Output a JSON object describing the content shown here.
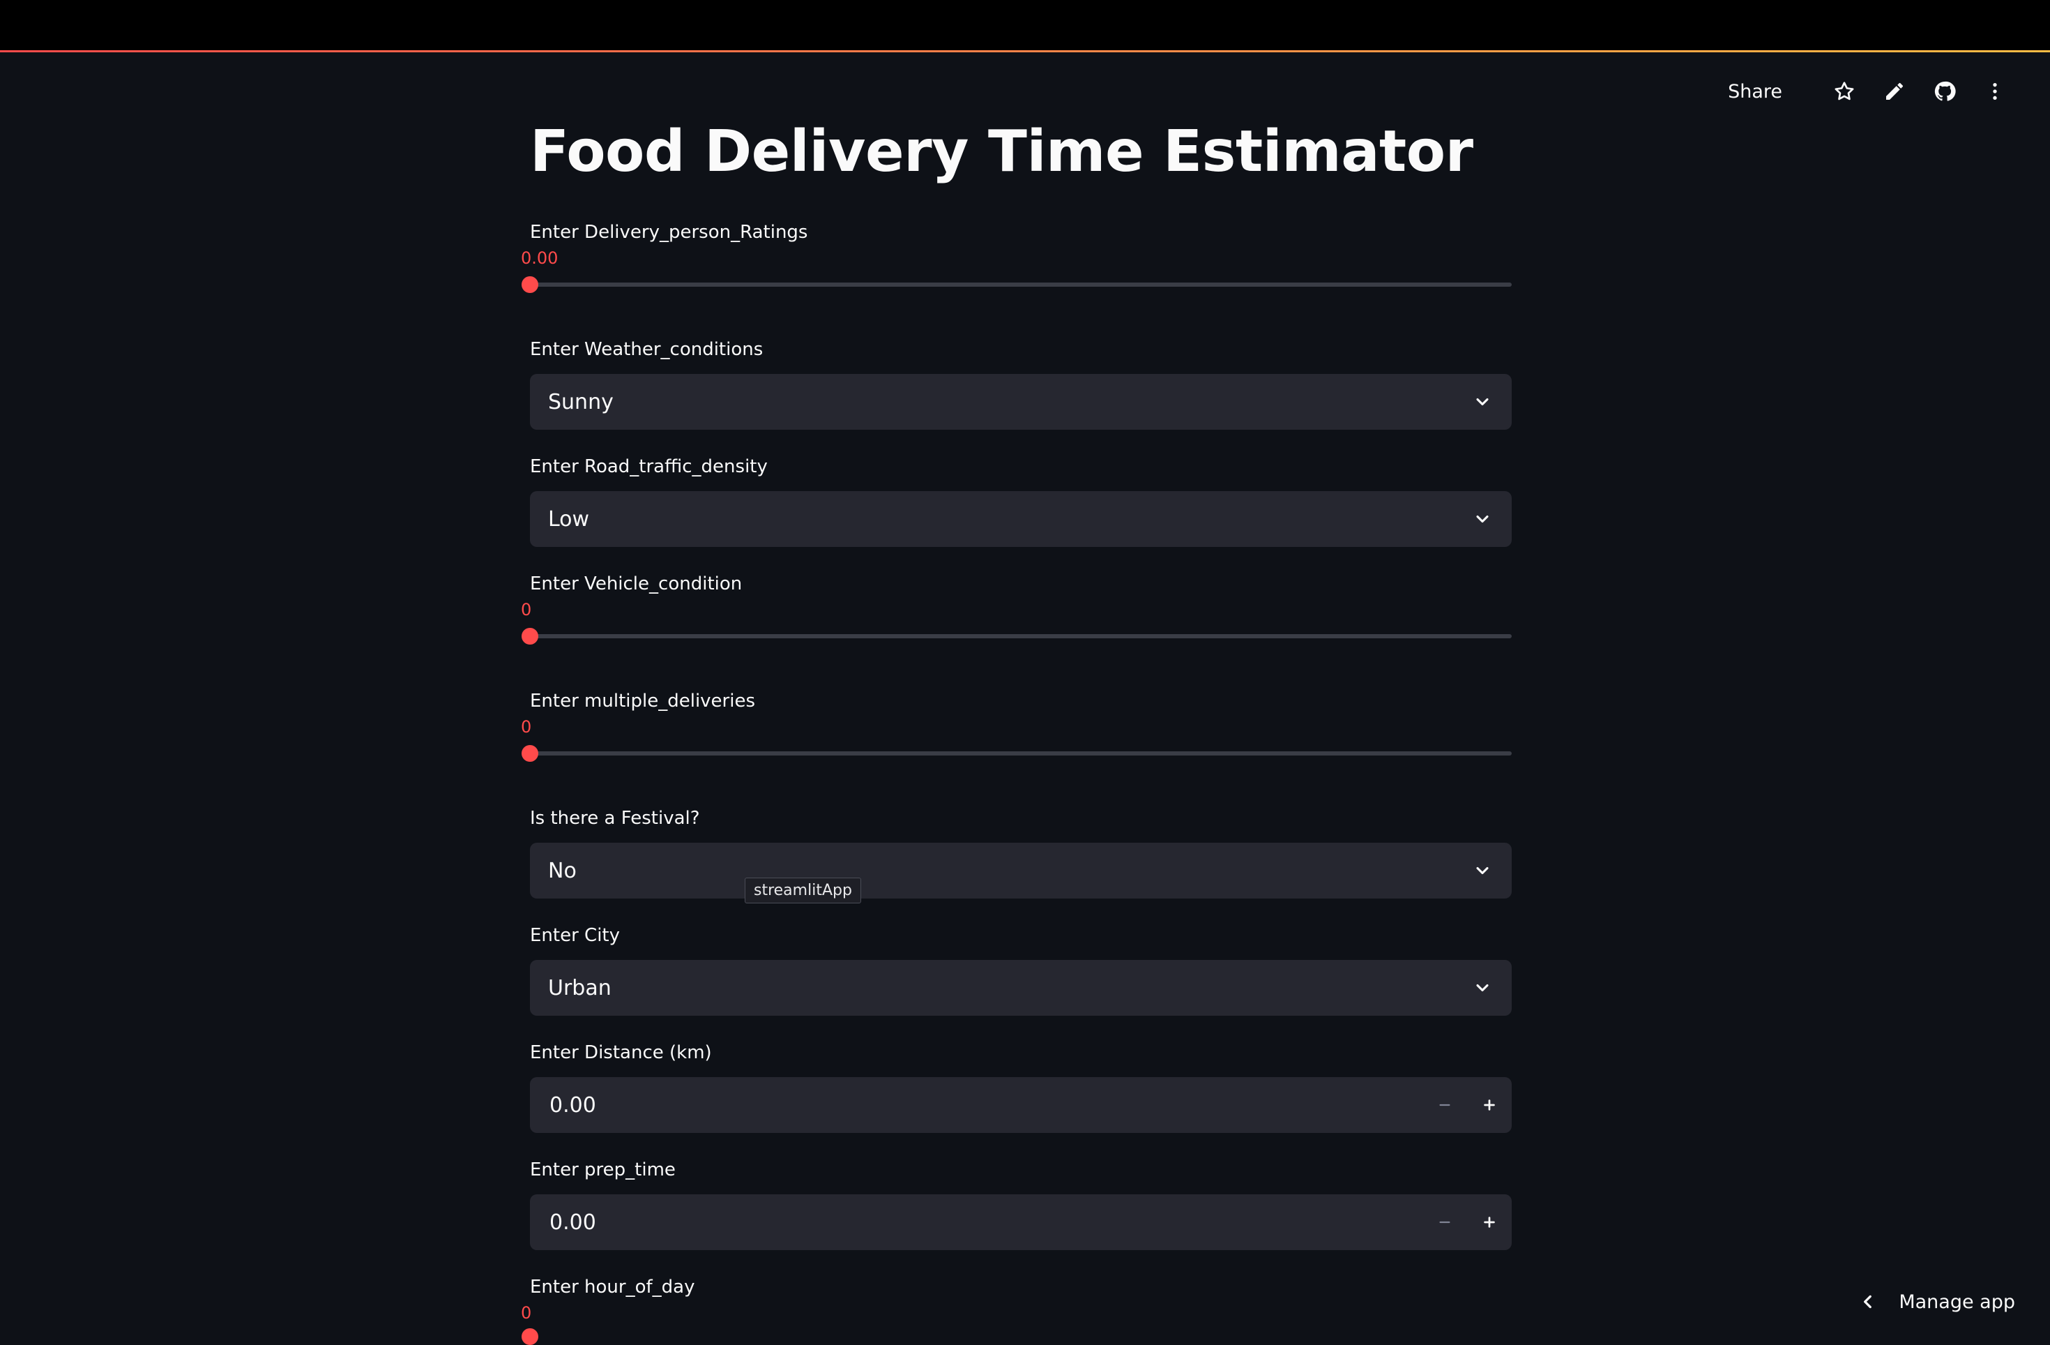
{
  "header": {
    "share_label": "Share",
    "icons": [
      "star-icon",
      "pencil-icon",
      "github-icon",
      "kebab-menu-icon"
    ]
  },
  "page": {
    "title": "Food Delivery Time Estimator"
  },
  "colors": {
    "accent": "#ff4b4b",
    "background": "#0e1117",
    "widget_bg": "#262730",
    "text": "#fafafa"
  },
  "form": {
    "ratings": {
      "label": "Enter Delivery_person_Ratings",
      "value_text": "0.00",
      "value": 0.0
    },
    "weather": {
      "label": "Enter Weather_conditions",
      "selected": "Sunny"
    },
    "traffic": {
      "label": "Enter Road_traffic_density",
      "selected": "Low"
    },
    "vehicle": {
      "label": "Enter Vehicle_condition",
      "value_text": "0",
      "value": 0
    },
    "deliveries": {
      "label": "Enter multiple_deliveries",
      "value_text": "0",
      "value": 0
    },
    "festival": {
      "label": "Is there a Festival?",
      "selected": "No"
    },
    "city": {
      "label": "Enter City",
      "selected": "Urban"
    },
    "distance": {
      "label": "Enter Distance (km)",
      "value": "0.00"
    },
    "prep_time": {
      "label": "Enter prep_time",
      "value": "0.00"
    },
    "hour": {
      "label": "Enter hour_of_day",
      "value_text": "0",
      "value": 0
    }
  },
  "tooltip": {
    "text": "streamlitApp"
  },
  "footer": {
    "manage_label": "Manage app"
  }
}
